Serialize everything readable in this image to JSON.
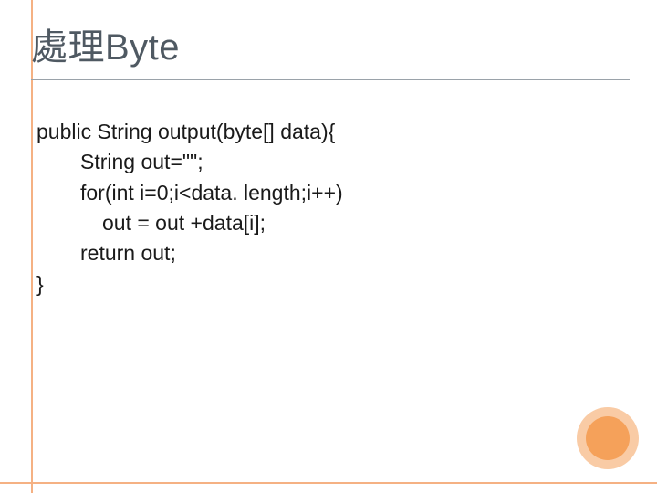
{
  "title": "處理Byte",
  "code": {
    "l1": "public String output(byte[] data){",
    "l2": "String out=\"\";",
    "l3": "for(int i=0;i<data. length;i++)",
    "l4": "out = out +data[i];",
    "l5": "return out;",
    "l6": "}"
  },
  "colors": {
    "accent": "#f5b183",
    "title": "#4f5962",
    "dot_outer": "#f9cba5",
    "dot_inner": "#f5a15a"
  }
}
